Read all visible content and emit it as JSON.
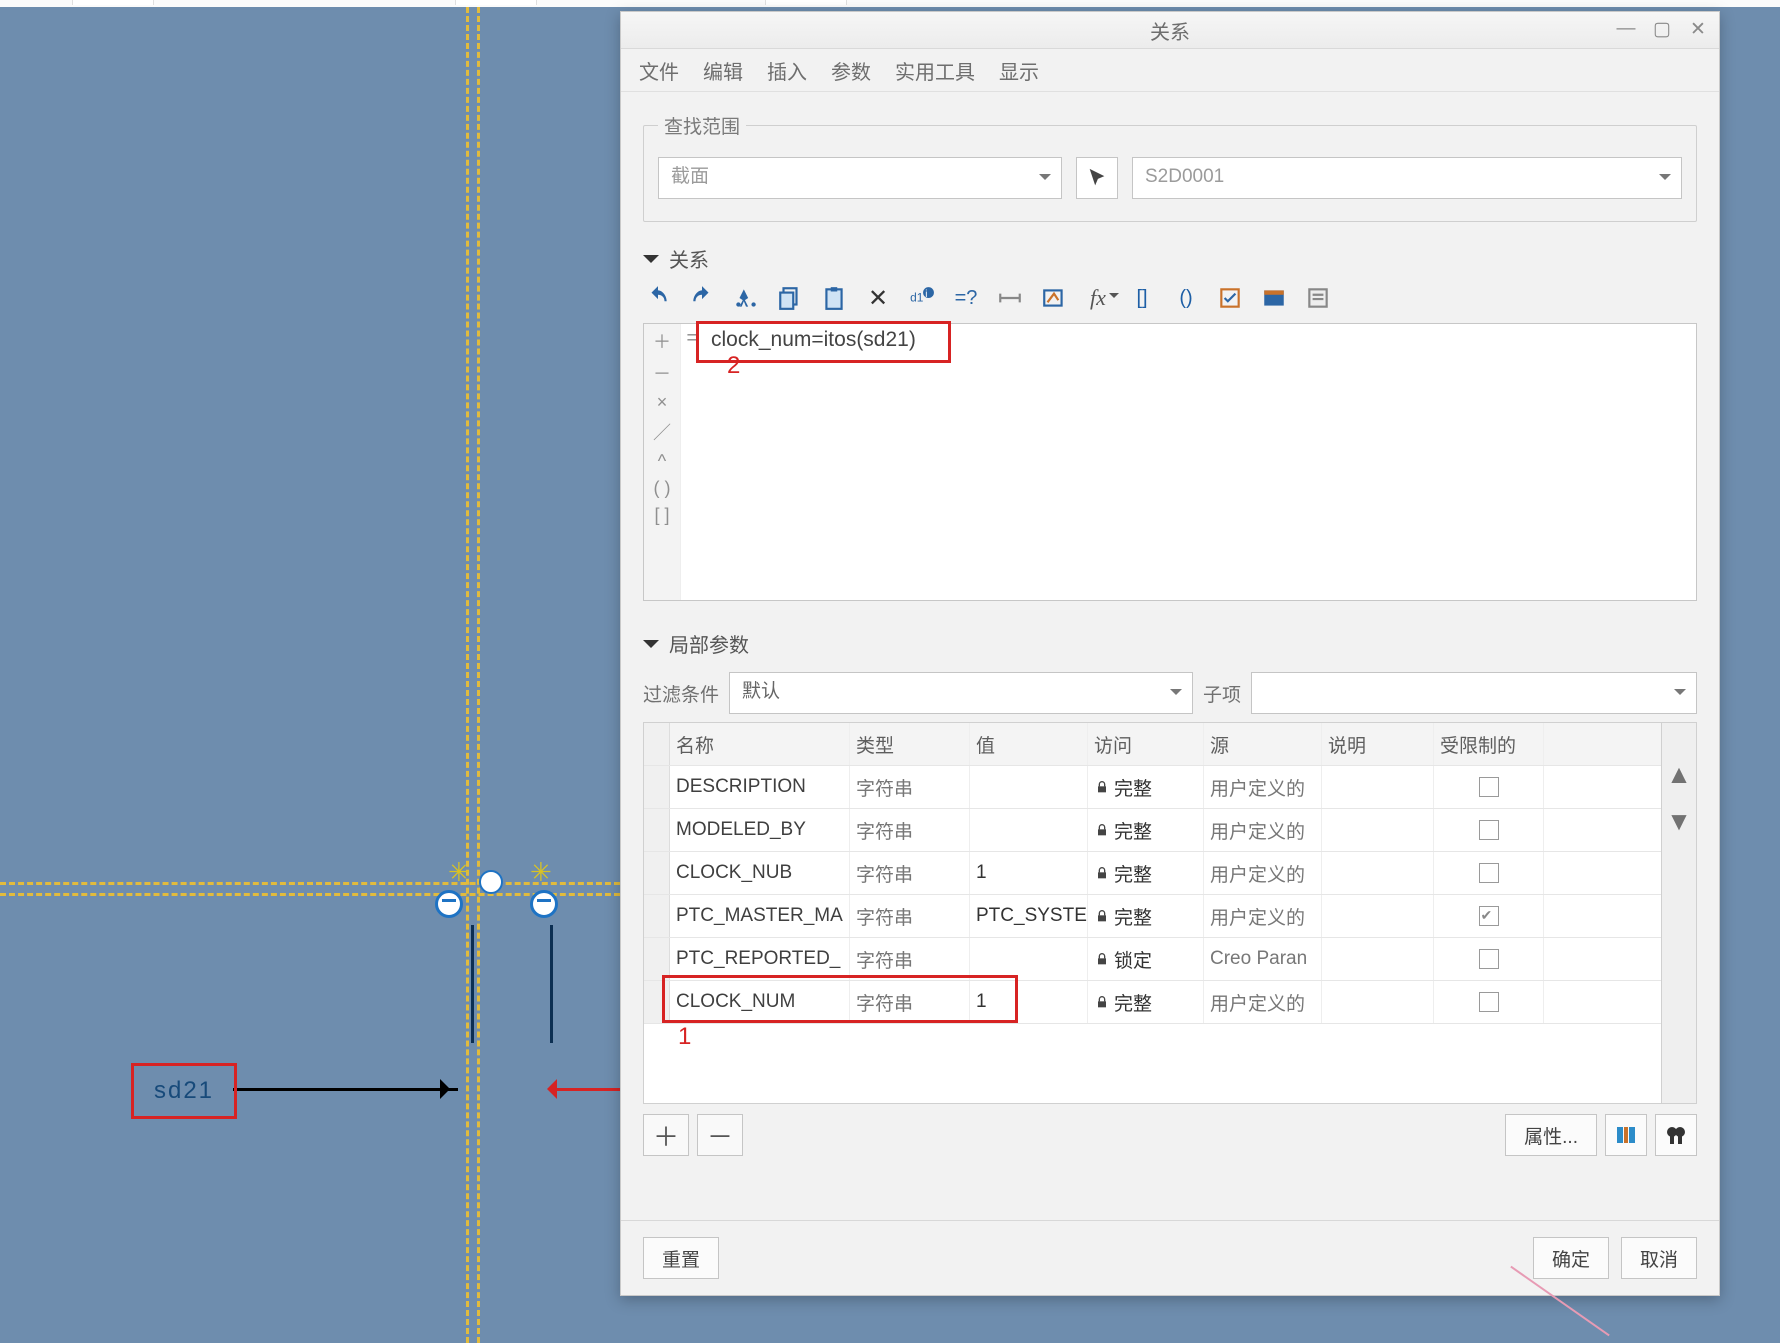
{
  "window": {
    "title": "关系",
    "menus": [
      "文件",
      "编辑",
      "插入",
      "参数",
      "实用工具",
      "显示"
    ]
  },
  "scope": {
    "legend": "查找范围",
    "combo1": "截面",
    "combo2": "S2D0001"
  },
  "relations": {
    "header": "关系",
    "gutter": [
      "＋",
      "－",
      "×",
      "／",
      "^",
      "( )",
      "[ ]"
    ],
    "eq_label": "=",
    "code": "clock_num=itos(sd21)",
    "annotation": "2"
  },
  "local_params": {
    "header": "局部参数",
    "filter_label": "过滤条件",
    "filter_combo": "默认",
    "sub_label": "子项",
    "annotation": "1",
    "columns": [
      "",
      "名称",
      "类型",
      "值",
      "访问",
      "源",
      "说明",
      "受限制的"
    ],
    "rows": [
      {
        "name": "DESCRIPTION",
        "type": "字符串",
        "value": "",
        "access": "完整",
        "source": "用户定义的",
        "restricted": false
      },
      {
        "name": "MODELED_BY",
        "type": "字符串",
        "value": "",
        "access": "完整",
        "source": "用户定义的",
        "restricted": false
      },
      {
        "name": "CLOCK_NUB",
        "type": "字符串",
        "value": "1",
        "access": "完整",
        "source": "用户定义的",
        "restricted": false
      },
      {
        "name": "PTC_MASTER_MA",
        "type": "字符串",
        "value": "PTC_SYSTE",
        "access": "完整",
        "source": "用户定义的",
        "restricted": true
      },
      {
        "name": "PTC_REPORTED_",
        "type": "字符串",
        "value": "",
        "access": "锁定",
        "source": "Creo Paran",
        "restricted": false
      },
      {
        "name": "CLOCK_NUM",
        "type": "字符串",
        "value": "1",
        "access": "完整",
        "source": "用户定义的",
        "restricted": false
      }
    ]
  },
  "buttons": {
    "reset": "重置",
    "ok": "确定",
    "cancel": "取消",
    "props": "属性..."
  },
  "canvas": {
    "dim_label": "sd21"
  }
}
